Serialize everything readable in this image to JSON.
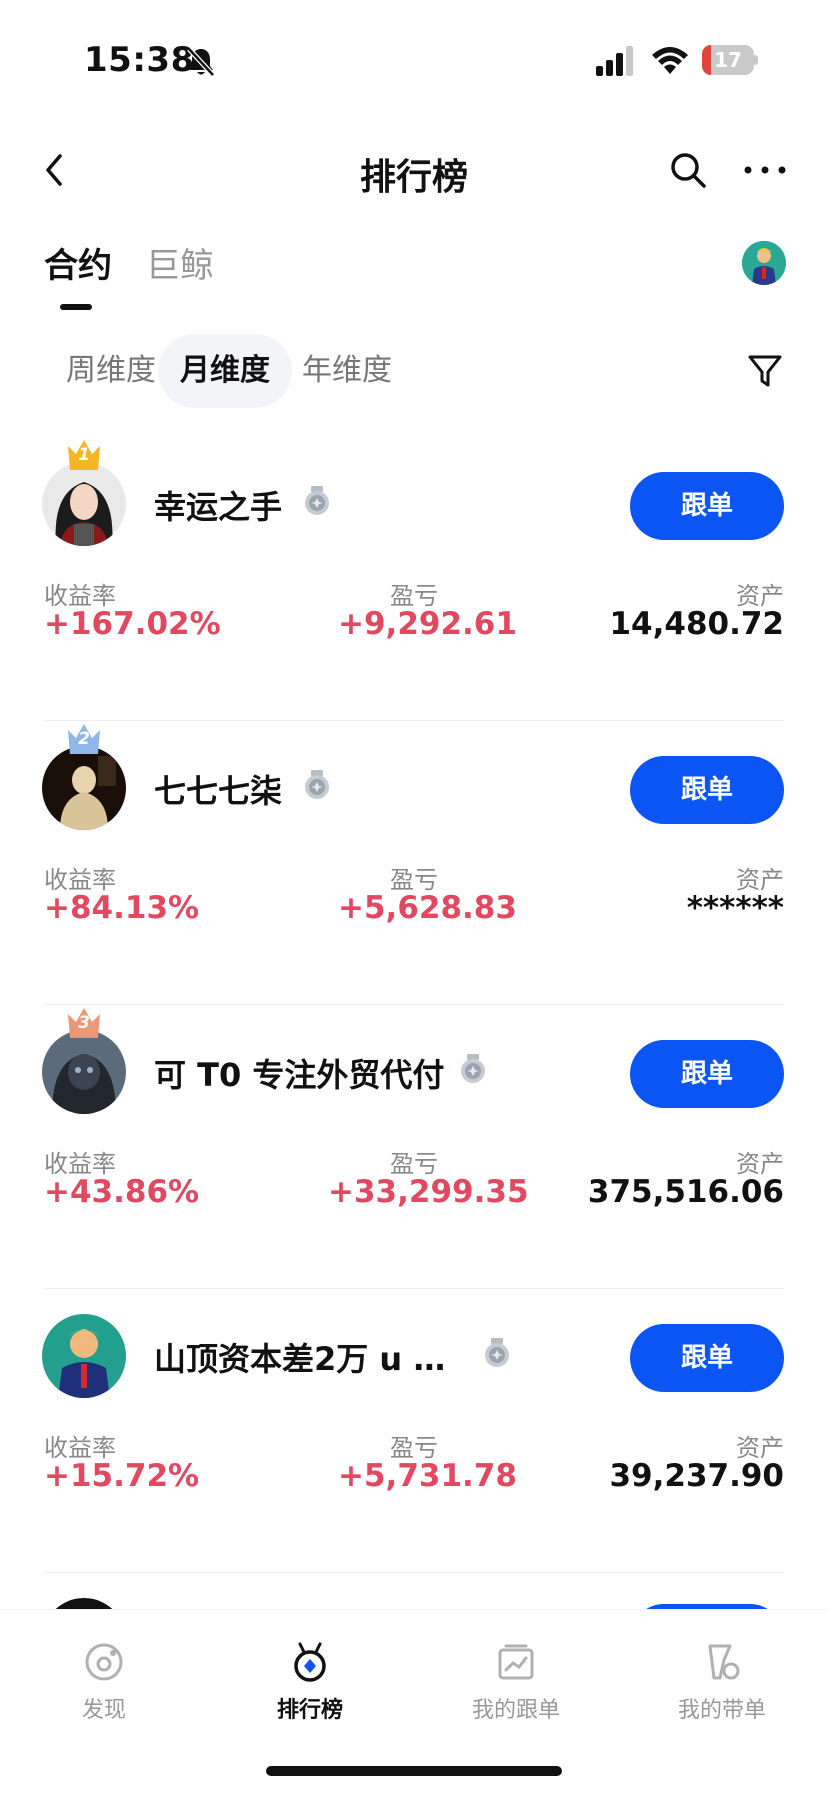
{
  "status_bar": {
    "time": "15:38",
    "battery_level": "17",
    "battery_fraction": 0.17,
    "icons": [
      "bell-slash-icon",
      "cellular-signal-icon",
      "wifi-icon",
      "battery-icon"
    ]
  },
  "nav": {
    "title": "排行榜",
    "back_icon": "chevron-left-icon",
    "search_icon": "search-icon",
    "more_icon": "more-horizontal-icon"
  },
  "main_tabs": [
    {
      "label": "合约",
      "active": true
    },
    {
      "label": "巨鲸",
      "active": false
    }
  ],
  "period_tabs": [
    {
      "label": "周维度",
      "selected": false
    },
    {
      "label": "月维度",
      "selected": true
    },
    {
      "label": "年维度",
      "selected": false
    }
  ],
  "column_labels": {
    "roi": "收益率",
    "pnl": "盈亏",
    "assets": "资产"
  },
  "follow_label": "跟单",
  "traders": [
    {
      "rank": "1",
      "name": "幸运之手",
      "roi": "+167.02%",
      "pnl": "+9,292.61",
      "assets": "14,480.72",
      "crown_color": "#f5b524"
    },
    {
      "rank": "2",
      "name": "七七七柒",
      "roi": "+84.13%",
      "pnl": "+5,628.83",
      "assets": "******",
      "crown_color": "#8fb6e6"
    },
    {
      "rank": "3",
      "name": "可 T0 专注外贸代付",
      "roi": "+43.86%",
      "pnl": "+33,299.35",
      "assets": "375,516.06",
      "crown_color": "#ec9877"
    },
    {
      "rank": "",
      "name": "山顶资本差2万 u …",
      "roi": "+15.72%",
      "pnl": "+5,731.78",
      "assets": "39,237.90",
      "crown_color": ""
    }
  ],
  "bottom_tabs": [
    {
      "label": "发现",
      "icon": "discover-icon",
      "active": false
    },
    {
      "label": "排行榜",
      "icon": "ranking-medal-icon",
      "active": true
    },
    {
      "label": "我的跟单",
      "icon": "my-copy-trades-icon",
      "active": false
    },
    {
      "label": "我的带单",
      "icon": "my-lead-trades-icon",
      "active": false
    }
  ],
  "colors": {
    "accent_blue": "#0b55f5",
    "profit_red": "#e2485f",
    "text_primary": "#111111",
    "text_secondary": "#888888"
  }
}
